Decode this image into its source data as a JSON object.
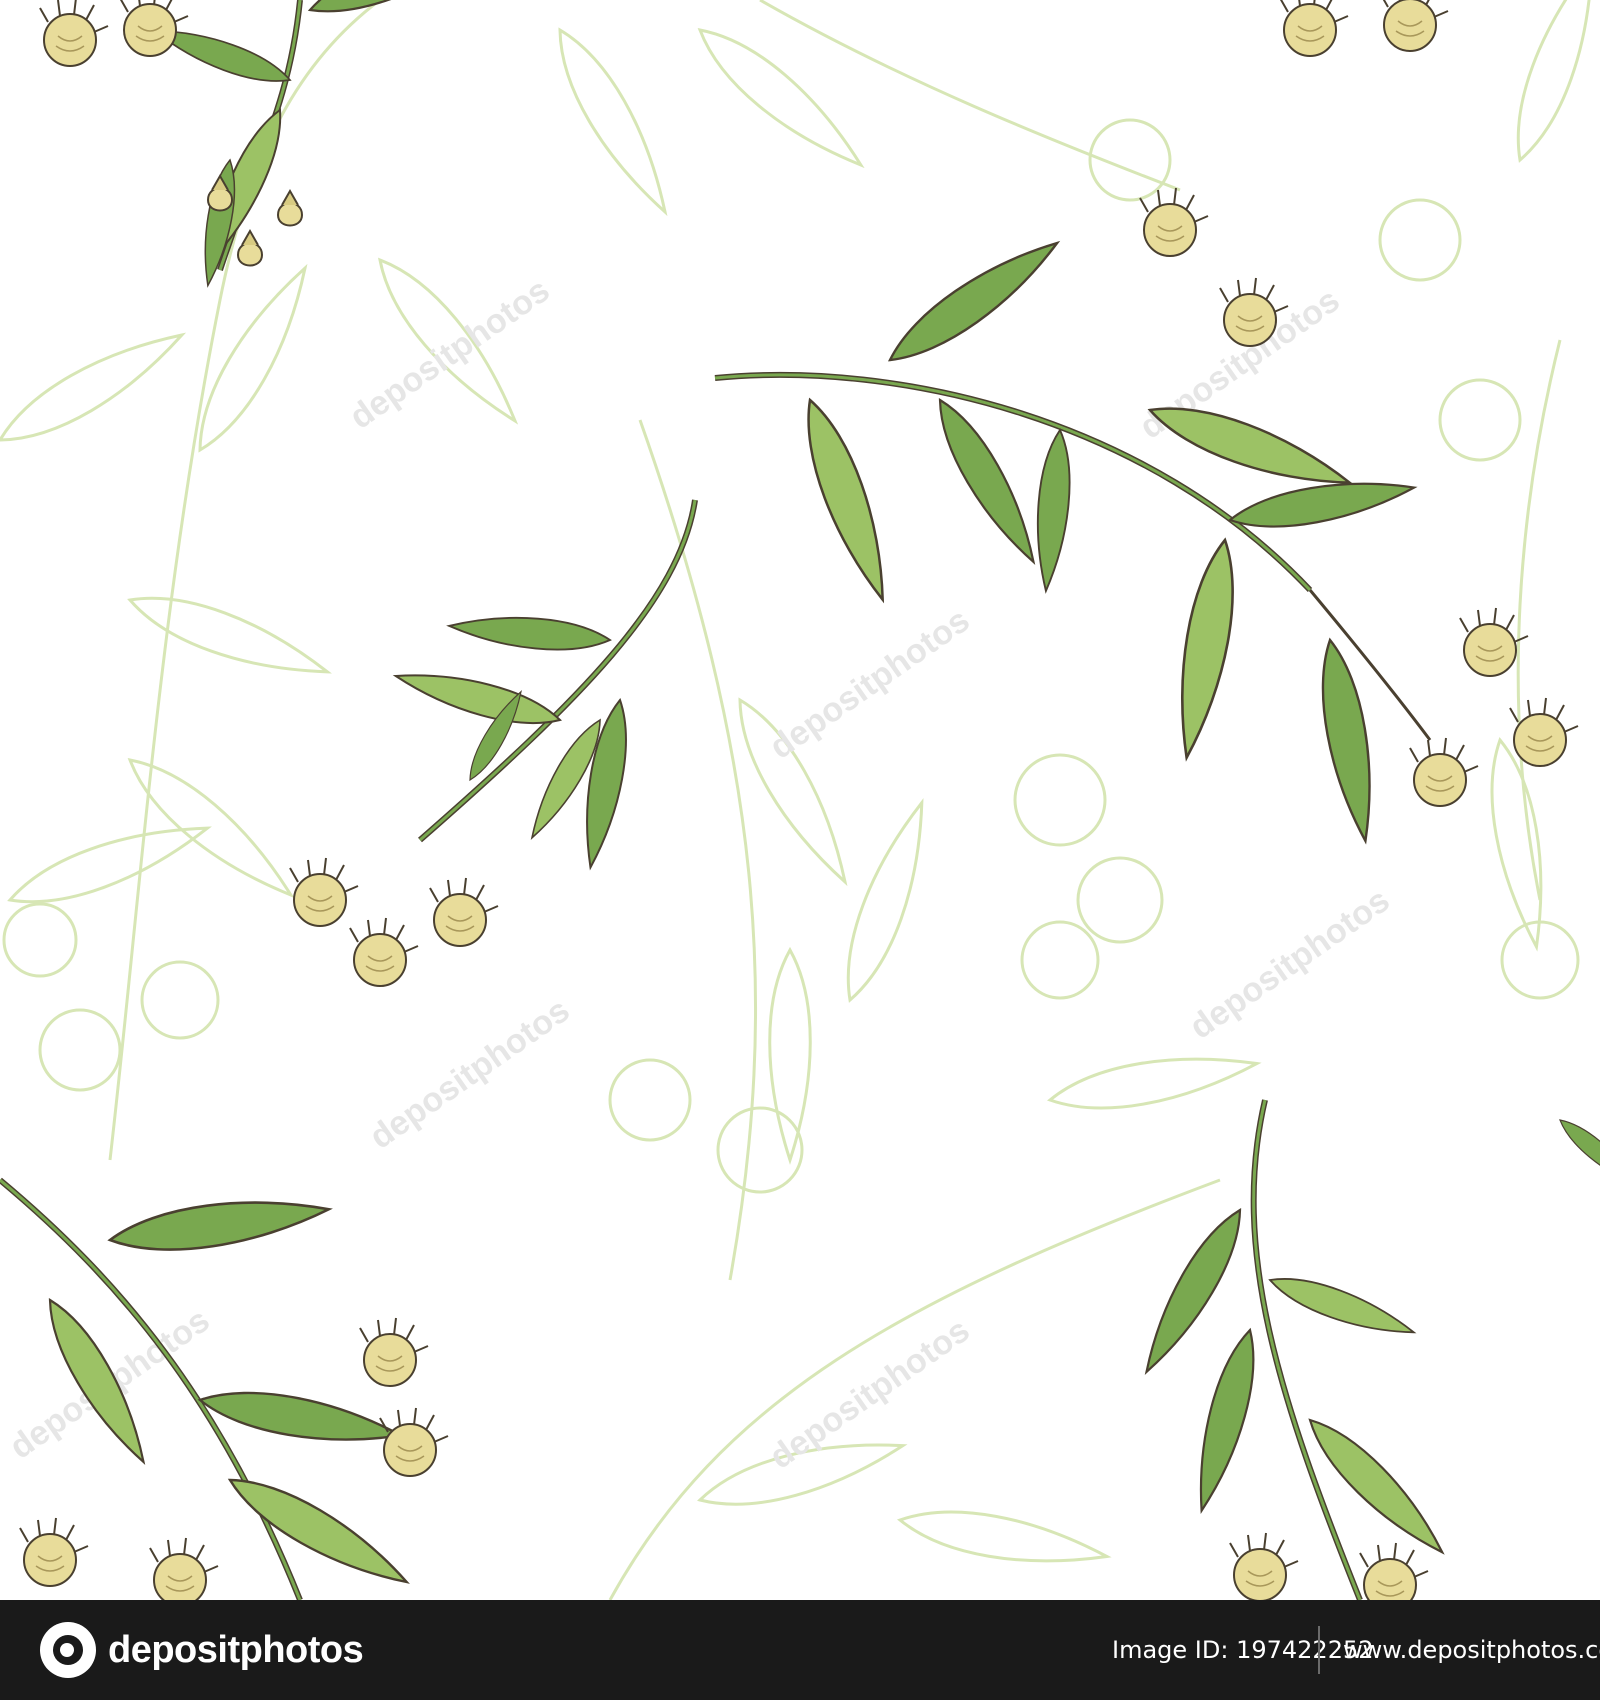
{
  "footer": {
    "brand_text": "depositphotos",
    "image_id_label": "Image ID:",
    "image_id_value": "197422252",
    "site_url": "www.depositphotos.com"
  },
  "watermark": {
    "text": "depositphotos"
  },
  "palette": {
    "leaf_fill": "#79a84f",
    "leaf_fill_light": "#9cc265",
    "outline": "#4a4030",
    "flower_fill": "#e8dc9a",
    "ghost_stroke": "#d7e6b5",
    "footer_bg": "#1a1a1a"
  },
  "icons": {
    "brand_logo": "depositphotos-logo-icon"
  }
}
